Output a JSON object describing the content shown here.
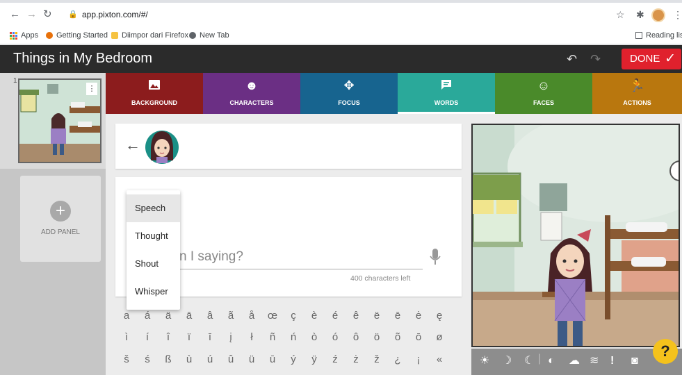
{
  "browser": {
    "url": "app.pixton.com/#/",
    "bookmarks": [
      {
        "label": "Apps",
        "color": "#4285f4"
      },
      {
        "label": "Getting Started",
        "color": "#e8710a"
      },
      {
        "label": "Diimpor dari Firefox",
        "color": "#f6c342"
      },
      {
        "label": "New Tab",
        "color": "#5f6368"
      }
    ],
    "reading_list": "Reading list",
    "icons": [
      "back-arrow-icon",
      "forward-arrow-icon",
      "reload-icon",
      "lock-icon",
      "star-icon",
      "extensions-icon",
      "menu-icon"
    ]
  },
  "app": {
    "title": "Things in My Bedroom",
    "done_label": "DONE",
    "accent": "#e0212d"
  },
  "sidebar": {
    "panel_number": "1",
    "add_panel_label": "ADD PANEL"
  },
  "tabs": [
    {
      "label": "BACKGROUND",
      "icon": "image-icon",
      "color": "#8c1c1d"
    },
    {
      "label": "CHARACTERS",
      "icon": "face-icon",
      "color": "#6b2f84"
    },
    {
      "label": "FOCUS",
      "icon": "focus-icon",
      "color": "#17648f"
    },
    {
      "label": "WORDS",
      "icon": "speech-bubble-icon",
      "color": "#2aa99a",
      "active": true
    },
    {
      "label": "FACES",
      "icon": "smiley-icon",
      "color": "#4a8a2a"
    },
    {
      "label": "ACTIONS",
      "icon": "running-figure-icon",
      "color": "#b9770e"
    }
  ],
  "words": {
    "placeholder": "n I saying?",
    "chars_left": "400 characters left",
    "bubble_types": [
      "Speech",
      "Thought",
      "Shout",
      "Whisper"
    ],
    "selected_type": "Speech"
  },
  "special_chars": [
    [
      "a",
      "á",
      "ä",
      "ā",
      "â",
      "ã",
      "å",
      "œ",
      "ç",
      "è",
      "é",
      "ê",
      "ë",
      "ē",
      "ė",
      "ę"
    ],
    [
      "ì",
      "í",
      "î",
      "ï",
      "ī",
      "į",
      "ł",
      "ñ",
      "ń",
      "ò",
      "ó",
      "ô",
      "ö",
      "õ",
      "ō",
      "ø"
    ],
    [
      "š",
      "ś",
      "ß",
      "ù",
      "ú",
      "û",
      "ü",
      "ū",
      "ý",
      "ÿ",
      "ź",
      "ż",
      "ž",
      "¿",
      "¡",
      "«"
    ]
  ],
  "help_label": "?"
}
